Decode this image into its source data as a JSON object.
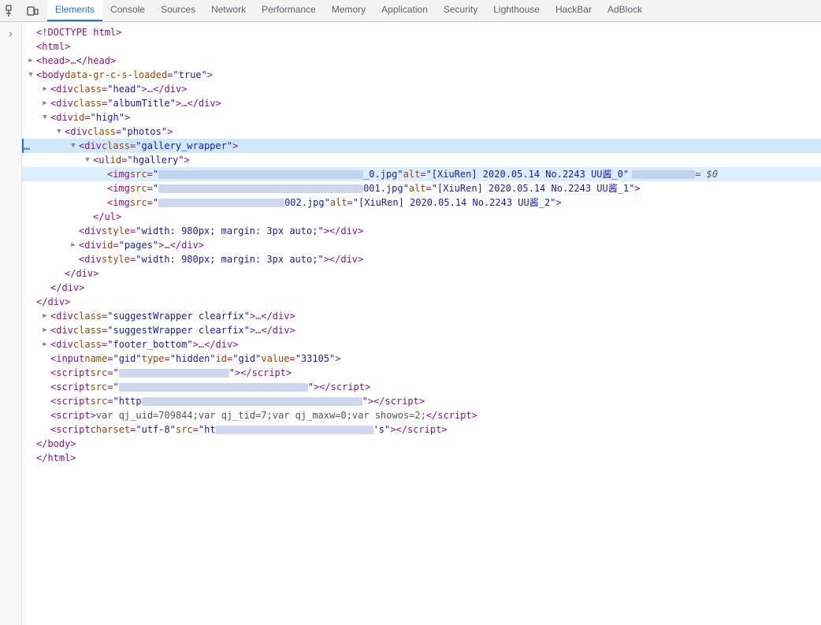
{
  "toolbar": {
    "tabs": [
      {
        "id": "elements",
        "label": "Elements",
        "active": true
      },
      {
        "id": "console",
        "label": "Console",
        "active": false
      },
      {
        "id": "sources",
        "label": "Sources",
        "active": false
      },
      {
        "id": "network",
        "label": "Network",
        "active": false
      },
      {
        "id": "performance",
        "label": "Performance",
        "active": false
      },
      {
        "id": "memory",
        "label": "Memory",
        "active": false
      },
      {
        "id": "application",
        "label": "Application",
        "active": false
      },
      {
        "id": "security",
        "label": "Security",
        "active": false
      },
      {
        "id": "lighthouse",
        "label": "Lighthouse",
        "active": false
      },
      {
        "id": "hackbar",
        "label": "HackBar",
        "active": false
      },
      {
        "id": "adblock",
        "label": "AdBlock",
        "active": false
      }
    ]
  },
  "dom": {
    "lines": [
      {
        "id": 1,
        "indent": 0,
        "arrow": "none",
        "content": "doctype",
        "selected": false
      },
      {
        "id": 2,
        "indent": 0,
        "arrow": "none",
        "content": "html_open",
        "selected": false
      },
      {
        "id": 3,
        "indent": 1,
        "arrow": "collapsed",
        "content": "head",
        "selected": false
      },
      {
        "id": 4,
        "indent": 1,
        "arrow": "expanded",
        "content": "body_open",
        "selected": false
      },
      {
        "id": 5,
        "indent": 2,
        "arrow": "collapsed",
        "content": "div_head",
        "selected": false
      },
      {
        "id": 6,
        "indent": 2,
        "arrow": "collapsed",
        "content": "div_albumTitle",
        "selected": false
      },
      {
        "id": 7,
        "indent": 2,
        "arrow": "expanded",
        "content": "div_high",
        "selected": false
      },
      {
        "id": 8,
        "indent": 3,
        "arrow": "expanded",
        "content": "div_photos",
        "selected": false
      },
      {
        "id": 9,
        "indent": 4,
        "arrow": "expanded",
        "content": "div_gallery_wrapper",
        "selected": true,
        "has_dots": true
      },
      {
        "id": 10,
        "indent": 5,
        "arrow": "expanded",
        "content": "ul_hgallery",
        "selected": false
      },
      {
        "id": 11,
        "indent": 6,
        "arrow": "none",
        "content": "img_0",
        "selected": false
      },
      {
        "id": 12,
        "indent": 6,
        "arrow": "none",
        "content": "img_1",
        "selected": false
      },
      {
        "id": 13,
        "indent": 6,
        "arrow": "none",
        "content": "img_2",
        "selected": false
      },
      {
        "id": 14,
        "indent": 5,
        "arrow": "none",
        "content": "ul_close",
        "selected": false
      },
      {
        "id": 15,
        "indent": 4,
        "arrow": "none",
        "content": "div_style_980",
        "selected": false
      },
      {
        "id": 16,
        "indent": 4,
        "arrow": "collapsed",
        "content": "div_pages",
        "selected": false
      },
      {
        "id": 17,
        "indent": 4,
        "arrow": "none",
        "content": "div_style_980_2",
        "selected": false
      },
      {
        "id": 18,
        "indent": 3,
        "arrow": "none",
        "content": "div_close_photos",
        "selected": false
      },
      {
        "id": 19,
        "indent": 2,
        "arrow": "none",
        "content": "div_close_high_inner",
        "selected": false
      },
      {
        "id": 20,
        "indent": 1,
        "arrow": "none",
        "content": "div_close_high",
        "selected": false
      },
      {
        "id": 21,
        "indent": 1,
        "arrow": "collapsed",
        "content": "div_suggestWrapper1",
        "selected": false
      },
      {
        "id": 22,
        "indent": 1,
        "arrow": "collapsed",
        "content": "div_suggestWrapper2",
        "selected": false
      },
      {
        "id": 23,
        "indent": 1,
        "arrow": "collapsed",
        "content": "div_footer_bottom",
        "selected": false
      },
      {
        "id": 24,
        "indent": 2,
        "arrow": "none",
        "content": "input_gid",
        "selected": false
      },
      {
        "id": 25,
        "indent": 2,
        "arrow": "none",
        "content": "script_1",
        "selected": false
      },
      {
        "id": 26,
        "indent": 2,
        "arrow": "none",
        "content": "script_2",
        "selected": false
      },
      {
        "id": 27,
        "indent": 2,
        "arrow": "none",
        "content": "script_3",
        "selected": false
      },
      {
        "id": 28,
        "indent": 2,
        "arrow": "none",
        "content": "script_qj",
        "selected": false
      },
      {
        "id": 29,
        "indent": 2,
        "arrow": "none",
        "content": "script_5",
        "selected": false
      },
      {
        "id": 30,
        "indent": 1,
        "arrow": "none",
        "content": "body_close",
        "selected": false
      },
      {
        "id": 31,
        "indent": 0,
        "arrow": "none",
        "content": "html_close",
        "selected": false
      }
    ]
  }
}
